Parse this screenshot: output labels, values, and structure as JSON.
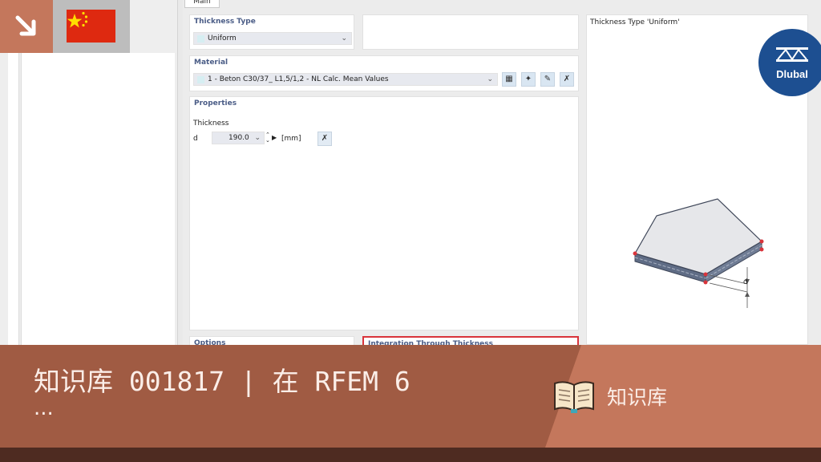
{
  "main_tab": "Main",
  "thickness_type": {
    "title": "Thickness Type",
    "value": "Uniform"
  },
  "material": {
    "title": "Material",
    "value": "1 - Beton C30/37_ L1,5/1,2 - NL Calc. Mean Values"
  },
  "properties": {
    "title": "Properties",
    "thickness_label": "Thickness",
    "symbol": "d",
    "value": "190.0",
    "unit": "[mm]"
  },
  "options": {
    "title": "Options"
  },
  "integration": {
    "title": "Integration Through Thickness"
  },
  "preview": {
    "title": "Thickness Type  'Uniform'",
    "dimension_label": "d"
  },
  "logo": {
    "text": "Dlubal"
  },
  "banner": {
    "title": "知识库 001817 | 在 RFEM 6",
    "subtitle": "...",
    "category": "知识库"
  },
  "colors": {
    "banner_dark": "#a05b43",
    "banner_light": "#c4775c",
    "bottom_bar": "#4e2b21",
    "section_title": "#4a5c86",
    "logo_blue": "#1d4f91",
    "flag_red": "#de2910",
    "highlight_red": "#d9343b"
  },
  "icons": [
    "arrow-down-right-icon",
    "china-flag-icon",
    "library-icon",
    "new-material-icon",
    "edit-material-icon",
    "pick-material-icon",
    "pick-value-icon",
    "book-icon"
  ]
}
